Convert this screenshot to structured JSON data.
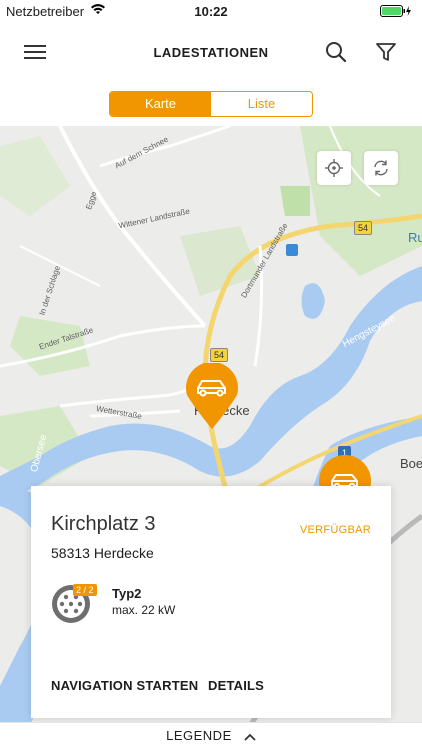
{
  "status_bar": {
    "carrier": "Netzbetreiber",
    "time": "10:22"
  },
  "nav": {
    "title": "LADESTATIONEN"
  },
  "view_toggle": {
    "map_label": "Karte",
    "list_label": "Liste",
    "selected": "Karte"
  },
  "map": {
    "street_labels": [
      "Auf dem Schnee",
      "Wittener Landstraße",
      "Dortmunder Landstraße",
      "In der Schlage",
      "Ender Talstraße",
      "Egge",
      "Wetterstraße",
      "Hengsteysee",
      "Obersee"
    ],
    "town_labels": [
      "Herdecke",
      "Ru",
      "Boe"
    ],
    "road_numbers": [
      "54",
      "54",
      "1"
    ]
  },
  "station_card": {
    "street": "Kirchplatz 3",
    "city": "58313 Herdecke",
    "status": "VERFÜGBAR",
    "connector": {
      "availability": "2 / 2",
      "type": "Typ2",
      "power": "max. 22 kW"
    },
    "actions": {
      "navigation": "NAVIGATION STARTEN",
      "details": "DETAILS"
    }
  },
  "legend": {
    "label": "LEGENDE"
  },
  "colors": {
    "accent": "#f19600",
    "water": "#a9cbf2",
    "park": "#c8e3b9"
  }
}
